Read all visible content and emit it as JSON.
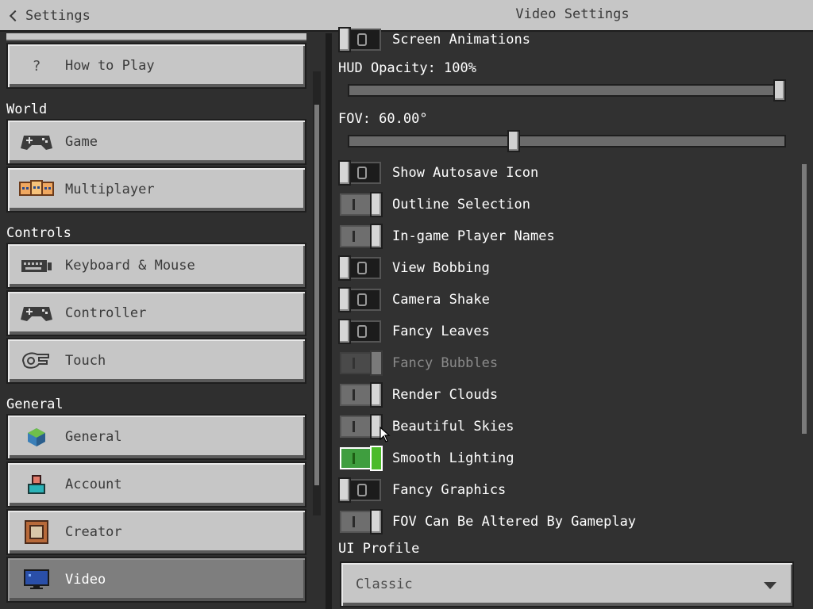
{
  "header": {
    "back_label": "Settings",
    "title": "Video Settings"
  },
  "sidebar": {
    "how_to_play": "How to Play",
    "sections": {
      "world": "World",
      "controls": "Controls",
      "general": "General"
    },
    "items": {
      "game": "Game",
      "multiplayer": "Multiplayer",
      "keyboard_mouse": "Keyboard & Mouse",
      "controller": "Controller",
      "touch": "Touch",
      "general": "General",
      "account": "Account",
      "creator": "Creator",
      "video": "Video"
    },
    "selected": "video"
  },
  "video": {
    "screen_animations": {
      "label": "Screen Animations",
      "state": "off"
    },
    "hud_opacity": {
      "label": "HUD Opacity: 100%",
      "value": 100,
      "min": 0,
      "max": 100
    },
    "fov": {
      "label": "FOV: 60.00°",
      "value": 60,
      "min": 30,
      "max": 110
    },
    "toggles": [
      {
        "label": "Show Autosave Icon",
        "state": "off"
      },
      {
        "label": "Outline Selection",
        "state": "on"
      },
      {
        "label": "In-game Player Names",
        "state": "on"
      },
      {
        "label": "View Bobbing",
        "state": "off"
      },
      {
        "label": "Camera Shake",
        "state": "off"
      },
      {
        "label": "Fancy Leaves",
        "state": "off"
      },
      {
        "label": "Fancy Bubbles",
        "state": "on",
        "disabled": true
      },
      {
        "label": "Render Clouds",
        "state": "on"
      },
      {
        "label": "Beautiful Skies",
        "state": "on"
      },
      {
        "label": "Smooth Lighting",
        "state": "on",
        "highlighted": true
      },
      {
        "label": "Fancy Graphics",
        "state": "off"
      },
      {
        "label": "FOV Can Be Altered By Gameplay",
        "state": "on"
      }
    ],
    "ui_profile": {
      "label": "UI Profile",
      "value": "Classic"
    }
  },
  "colors": {
    "panel_bg": "#313131",
    "button_bg": "#c6c6c6",
    "selected_bg": "#7e7e7e",
    "toggle_highlight": "#4cbb2a"
  }
}
